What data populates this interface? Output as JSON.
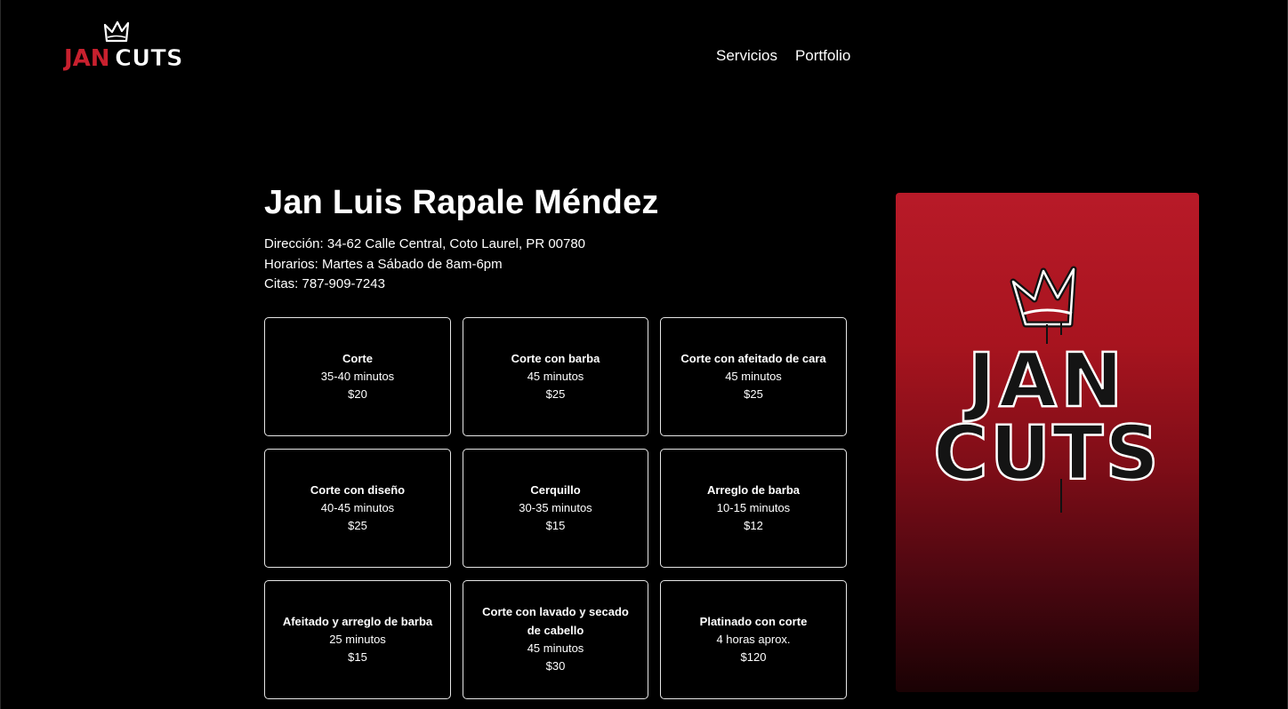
{
  "brand": {
    "logo_text_red": "JAN",
    "logo_text_white": "CUTS",
    "accent": "#c8202e"
  },
  "nav": [
    {
      "label": "Servicios"
    },
    {
      "label": "Portfolio"
    }
  ],
  "profile": {
    "name": "Jan Luis Rapale Méndez",
    "address": "Dirección: 34-62 Calle Central, Coto Laurel, PR 00780",
    "hours": "Horarios: Martes a Sábado de 8am-6pm",
    "appointments": "Citas: 787-909-7243"
  },
  "services": [
    {
      "name": "Corte",
      "duration": "35-40 minutos",
      "price": "$20"
    },
    {
      "name": "Corte con barba",
      "duration": "45 minutos",
      "price": "$25"
    },
    {
      "name": "Corte con afeitado de cara",
      "duration": "45 minutos",
      "price": "$25"
    },
    {
      "name": "Corte con diseño",
      "duration": "40-45 minutos",
      "price": "$25"
    },
    {
      "name": "Cerquillo",
      "duration": "30-35 minutos",
      "price": "$15"
    },
    {
      "name": "Arreglo de barba",
      "duration": "10-15 minutos",
      "price": "$12"
    },
    {
      "name": "Afeitado y arreglo de barba",
      "duration": "25 minutos",
      "price": "$15"
    },
    {
      "name": "Corte con lavado y secado de cabello",
      "duration": "45 minutos",
      "price": "$30"
    },
    {
      "name": "Platinado con corte",
      "duration": "4 horas aprox.",
      "price": "$120"
    }
  ],
  "poster": {
    "line1": "JAN",
    "line2": "CUTS",
    "icon": "crown-icon"
  }
}
